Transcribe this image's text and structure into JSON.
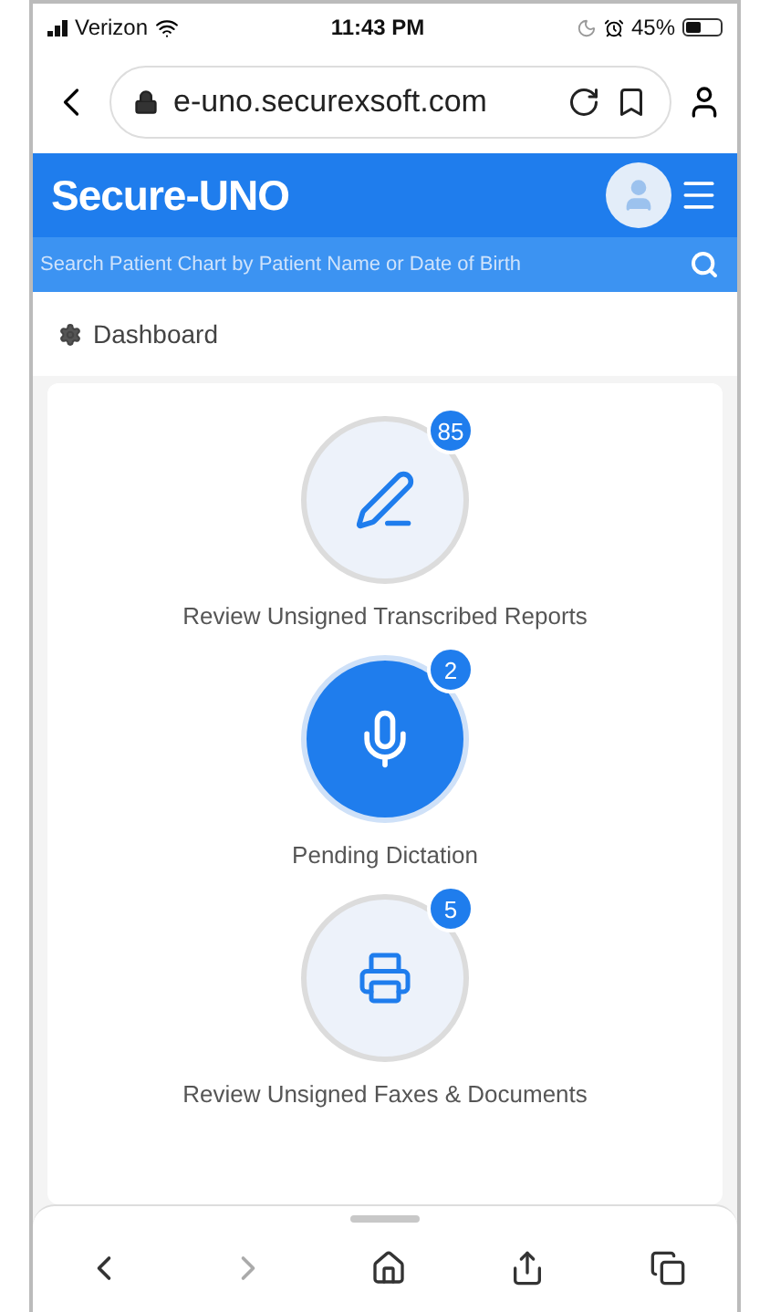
{
  "status_bar": {
    "carrier": "Verizon",
    "time": "11:43 PM",
    "battery": "45%"
  },
  "address_bar": {
    "url": "e-uno.securexsoft.com"
  },
  "header": {
    "logo": "Secure-UNO"
  },
  "search": {
    "placeholder": "Search Patient Chart by Patient Name or Date of Birth"
  },
  "breadcrumb": "Dashboard",
  "tiles": [
    {
      "kind": "pen",
      "label": "Review Unsigned Transcribed Reports",
      "count": "85",
      "selected": false
    },
    {
      "kind": "mic",
      "label": "Pending Dictation",
      "count": "2",
      "selected": true
    },
    {
      "kind": "printer",
      "label": "Review Unsigned Faxes & Documents",
      "count": "5",
      "selected": false
    }
  ],
  "toolbar": {
    "back_disabled": false,
    "forward_disabled": true
  }
}
